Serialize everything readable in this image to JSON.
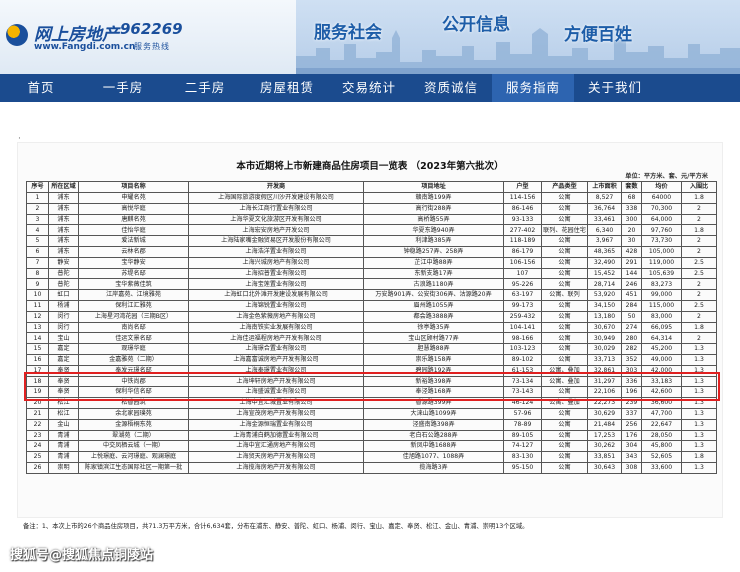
{
  "header": {
    "logo_text": "网上房地产",
    "logo_url": "www.Fangdi.com.cn",
    "hotline_number": "962269",
    "hotline_label": "服务热线",
    "slogans": [
      "服务社会",
      "公开信息",
      "方便百姓"
    ]
  },
  "nav": {
    "items": [
      "首页",
      "一手房",
      "二手房",
      "房屋租赁",
      "交易统计",
      "资质诚信",
      "服务指南",
      "关于我们"
    ],
    "active_index": 6
  },
  "page": {
    "dot": "·",
    "title": "本市近期将上市新建商品住房项目一览表 （2023年第六批次）",
    "unit": "单位：平方米、套、元/平方米",
    "note": "备注：1、本次上市的26个商品住房项目，共71.3万平方米，合计6,634套，分布在浦东、静安、普陀、虹口、杨浦、闵行、宝山、嘉定、奉贤、松江、金山、青浦、崇明13个区域。",
    "watermark": "搜狐号@搜狐焦点铜陵站"
  },
  "table": {
    "headers": [
      "序号",
      "所在区域",
      "项目名称",
      "开发商",
      "项目地址",
      "户型",
      "产品类型",
      "上市面积",
      "套数",
      "均价",
      "入围比"
    ],
    "highlight_rows": [
      3,
      4
    ],
    "rows": [
      [
        "1",
        "浦东",
        "申耀名苑",
        "上海国际旅游度假区川沙开发建设有限公司",
        "赣南路199弄",
        "114-156",
        "公寓",
        "8,527",
        "68",
        "64000",
        "1.8"
      ],
      [
        "2",
        "浦东",
        "高悦华庭",
        "上海长江商行置业有限公司",
        "高行街288弄",
        "86-146",
        "公寓",
        "36,764",
        "338",
        "70,300",
        "2"
      ],
      [
        "3",
        "浦东",
        "唐麒名苑",
        "上海华夏文化旅游区开发有限公司",
        "高桥路55弄",
        "93-133",
        "公寓",
        "33,461",
        "300",
        "64,000",
        "2"
      ],
      [
        "4",
        "浦东",
        "佳怡华庭",
        "上海宏安房地产开发公司",
        "华夏东路940弄",
        "277-402",
        "联列、花园住宅",
        "6,340",
        "20",
        "97,760",
        "1.8"
      ],
      [
        "5",
        "浦东",
        "爱法新城",
        "上海陆家嘴金融贸易区开发股份有限公司",
        "利津路385弄",
        "118-189",
        "公寓",
        "3,967",
        "30",
        "73,730",
        "2"
      ],
      [
        "6",
        "浦东",
        "云林名郡",
        "上海浩洋置业有限公司",
        "钟稳路257弄、258弄",
        "86-179",
        "公寓",
        "48,365",
        "428",
        "105,000",
        "2"
      ],
      [
        "7",
        "静安",
        "宝华静安",
        "上海兴城房地产有限公司",
        "芷江中路88弄",
        "106-156",
        "公寓",
        "32,490",
        "291",
        "119,000",
        "2.5"
      ],
      [
        "8",
        "普陀",
        "苏堤名邸",
        "上海招普置业有限公司",
        "东新支路17弄",
        "107",
        "公寓",
        "15,452",
        "144",
        "105,639",
        "2.5"
      ],
      [
        "9",
        "普陀",
        "宝华紫薇佳筑",
        "上海宝莲置业有限公司",
        "古浪路1180弄",
        "95-226",
        "公寓",
        "28,714",
        "246",
        "83,273",
        "2"
      ],
      [
        "10",
        "虹口",
        "江岸嘉苑、江境雅苑",
        "上海虹口北外滩开发建设发展有限公司",
        "万安路901弄、公安街306弄、沽源路20弄",
        "63-197",
        "公寓、联列",
        "53,920",
        "451",
        "99,000",
        "2"
      ],
      [
        "11",
        "杨浦",
        "保利江汇雅苑",
        "上海锦锐置业有限公司",
        "眉州路1055弄",
        "99-173",
        "公寓",
        "34,150",
        "284",
        "115,000",
        "2.5"
      ],
      [
        "12",
        "闵行",
        "上海星河湾花园（三期B区）",
        "上海金色紫薇房地产有限公司",
        "都会路3888弄",
        "259-432",
        "公寓",
        "13,180",
        "50",
        "83,000",
        "2"
      ],
      [
        "13",
        "闵行",
        "南尚名邸",
        "上海南铁实业发展有限公司",
        "徐亭路35弄",
        "104-141",
        "公寓",
        "30,670",
        "274",
        "66,095",
        "1.8"
      ],
      [
        "14",
        "宝山",
        "佳运文景名邸",
        "上海佳运福程房地产开发有限公司",
        "宝山区顾村路77弄",
        "98-166",
        "公寓",
        "30,949",
        "280",
        "64,314",
        "2"
      ],
      [
        "15",
        "嘉定",
        "观璟华庭",
        "上海璟合置业有限公司",
        "胆慧路88弄",
        "103-123",
        "公寓",
        "30,029",
        "282",
        "45,200",
        "1.3"
      ],
      [
        "16",
        "嘉定",
        "金嘉雅苑（二期）",
        "上海嘉富诚房地产开发有限公司",
        "崇乐路158弄",
        "89-102",
        "公寓",
        "33,713",
        "352",
        "49,000",
        "1.3"
      ],
      [
        "17",
        "奉贤",
        "奉发元璟名邸",
        "上海奉璟置业有限公司",
        "碧园路192弄",
        "61-153",
        "公寓、叠加",
        "32,861",
        "303",
        "42,000",
        "1.3"
      ],
      [
        "18",
        "奉贤",
        "中铁尚郡",
        "上海坤轩房地产开发有限公司",
        "新裕路398弄",
        "73-134",
        "公寓、叠加",
        "31,297",
        "336",
        "33,183",
        "1.3"
      ],
      [
        "19",
        "奉贤",
        "保利华信名邸",
        "上海盛诚置业有限公司",
        "奉泾路168弄",
        "73-143",
        "公寓",
        "22,106",
        "196",
        "42,600",
        "1.3"
      ],
      [
        "20",
        "松江",
        "松香园筑",
        "上海中宜汇城置业有限公司",
        "香源路399弄",
        "46-124",
        "公寓、叠加",
        "22,273",
        "239",
        "36,600",
        "1.3"
      ],
      [
        "21",
        "松江",
        "余北家园璞苑",
        "上海宣茂房地产开发有限公司",
        "大涞山路1099弄",
        "57-96",
        "公寓",
        "30,629",
        "337",
        "47,700",
        "1.3"
      ],
      [
        "22",
        "金山",
        "金源梧桐东苑",
        "上海金源恒瑞置业有限公司",
        "泾盛南路398弄",
        "78-89",
        "公寓",
        "21,484",
        "256",
        "22,647",
        "1.3"
      ],
      [
        "23",
        "青浦",
        "翠湖苑（二期）",
        "上海青浦白鹤加德置业有限公司",
        "老白石公路288弄",
        "89-105",
        "公寓",
        "17,253",
        "176",
        "28,050",
        "1.3"
      ],
      [
        "24",
        "青浦",
        "中交凤栖云城（一期）",
        "上海中宜汇通房地产有限公司",
        "新凤中路1688弄",
        "74-127",
        "公寓",
        "30,262",
        "304",
        "45,800",
        "1.3"
      ],
      [
        "25",
        "青浦",
        "上悦璟庭、云河璟庭、观澜璟庭",
        "上海贸天房地产开发有限公司",
        "佳旭路1077、1088弄",
        "83-130",
        "公寓",
        "33,851",
        "343",
        "52,605",
        "1.8"
      ],
      [
        "26",
        "崇明",
        "陈家镇滨江生态国际社区一期第一批",
        "上海揽海房地产开发有限公司",
        "揽海路3弄",
        "95-150",
        "公寓",
        "30,643",
        "308",
        "33,600",
        "1.3"
      ]
    ]
  }
}
